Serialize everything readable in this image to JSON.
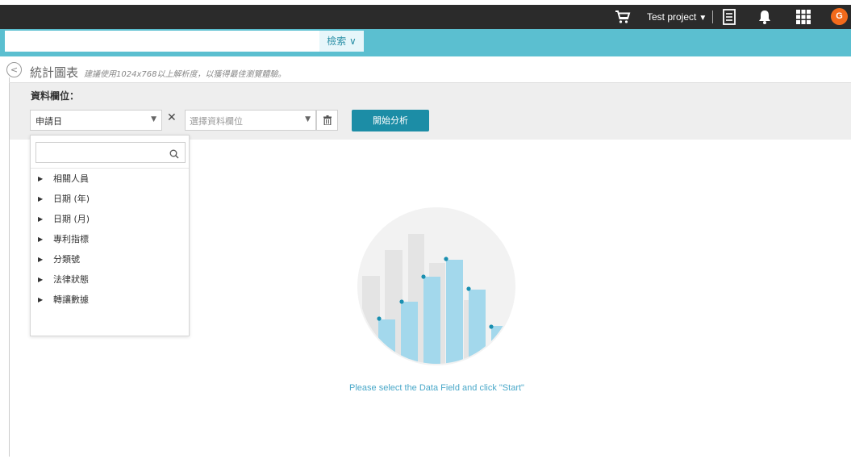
{
  "topbar": {
    "project_label": "Test project",
    "avatar_initial": "G",
    "icons": [
      "cart-icon",
      "caret-down-icon",
      "document-icon",
      "bell-icon",
      "apps-grid-icon"
    ]
  },
  "search_bar": {
    "toggle_label": "檢索 ∨"
  },
  "header": {
    "title": "統計圖表",
    "hint": "建議使用1024x768以上解析度，以獲得最佳瀏覽體驗。"
  },
  "filter": {
    "label": "資料欄位：",
    "field1_value": "申請日",
    "field2_placeholder": "選擇資料欄位",
    "start_button": "開始分析"
  },
  "dropdown": {
    "items": [
      {
        "label": "相關人員"
      },
      {
        "label": "日期 (年)"
      },
      {
        "label": "日期 (月)"
      },
      {
        "label": "專利指標"
      },
      {
        "label": "分類號"
      },
      {
        "label": "法律狀態"
      },
      {
        "label": "轉讓數據"
      }
    ]
  },
  "empty_state": {
    "message": "Please select the Data Field and click \"Start\""
  },
  "colors": {
    "topbar_bg": "#2b2b2b",
    "teal": "#5bbfd0",
    "start_button": "#1c8da6",
    "avatar": "#f26a1b",
    "bar_blue": "#a3d8ec",
    "dot": "#1a8fb0",
    "message": "#4aa8c9"
  }
}
